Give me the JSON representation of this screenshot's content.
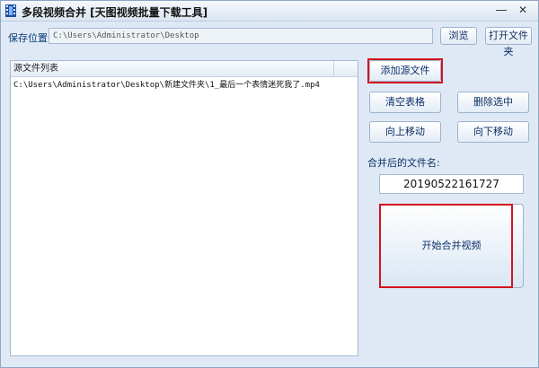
{
  "window": {
    "title": "多段视频合并 [天图视频批量下载工具]",
    "minimize_glyph": "—",
    "close_glyph": "✕"
  },
  "save": {
    "label": "保存位置:",
    "path": "C:\\Users\\Administrator\\Desktop",
    "browse_label": "浏览",
    "open_folder_label": "打开文件夹"
  },
  "file_list": {
    "column_header": "源文件列表",
    "rows": [
      "C:\\Users\\Administrator\\Desktop\\新建文件夹\\1_最后一个表情迷死我了.mp4"
    ]
  },
  "actions": {
    "add_source": "添加源文件",
    "clear_table": "清空表格",
    "delete_selected": "删除选中",
    "move_up": "向上移动",
    "move_down": "向下移动"
  },
  "output": {
    "label": "合并后的文件名:",
    "filename": "20190522161727",
    "start_label": "开始合并视频"
  },
  "colors": {
    "highlight": "#d3141f",
    "window_bg": "#dfe9f5",
    "label_blue": "#0b3a7a"
  }
}
